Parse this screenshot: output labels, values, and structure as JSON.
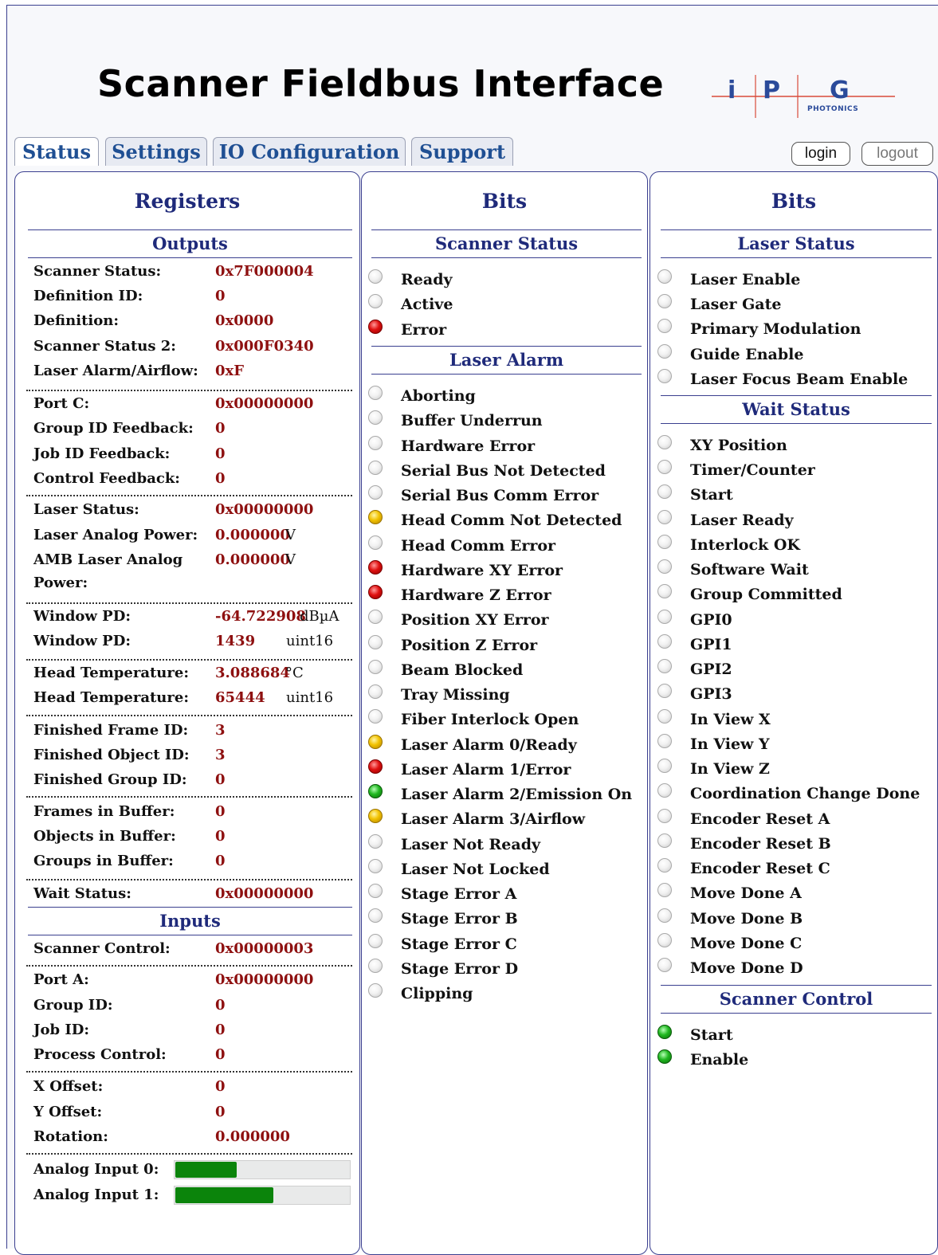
{
  "app": {
    "title": "Scanner Fieldbus Interface"
  },
  "logo": {
    "letters": [
      "i",
      "P",
      "G"
    ],
    "sub": "PHOTONICS"
  },
  "tabs": [
    {
      "label": "Status",
      "active": true
    },
    {
      "label": "Settings",
      "active": false
    },
    {
      "label": "IO Configuration",
      "active": false
    },
    {
      "label": "Support",
      "active": false
    }
  ],
  "auth": {
    "login": "login",
    "logout": "logout"
  },
  "registers": {
    "title": "Registers",
    "outputs_title": "Outputs",
    "inputs_title": "Inputs",
    "outputs": [
      {
        "label": "Scanner Status:",
        "value": "0x7F000004"
      },
      {
        "label": "Definition ID:",
        "value": "0"
      },
      {
        "label": "Definition:",
        "value": "0x0000"
      },
      {
        "label": "Scanner Status 2:",
        "value": "0x000F0340"
      },
      {
        "label": "Laser Alarm/Airflow:",
        "value": "0xF"
      },
      {
        "label": "Port C:",
        "value": "0x00000000"
      },
      {
        "label": "Group ID Feedback:",
        "value": "0"
      },
      {
        "label": "Job ID Feedback:",
        "value": "0"
      },
      {
        "label": "Control Feedback:",
        "value": "0"
      },
      {
        "label": "Laser Status:",
        "value": "0x00000000"
      },
      {
        "label": "Laser Analog Power:",
        "value": "0.000000",
        "unit": "V"
      },
      {
        "label": "AMB Laser Analog",
        "label2": "Power:",
        "value": "0.000000",
        "unit": "V"
      },
      {
        "label": "Window PD:",
        "value": "-64.722908",
        "unit": "dBµA"
      },
      {
        "label": "Window PD:",
        "value": "1439",
        "unit": "uint16"
      },
      {
        "label": "Head Temperature:",
        "value": "3.088684",
        "unit": "°C"
      },
      {
        "label": "Head Temperature:",
        "value": "65444",
        "unit": "uint16"
      },
      {
        "label": "Finished Frame ID:",
        "value": "3"
      },
      {
        "label": "Finished Object ID:",
        "value": "3"
      },
      {
        "label": "Finished Group ID:",
        "value": "0"
      },
      {
        "label": "Frames in Buffer:",
        "value": "0"
      },
      {
        "label": "Objects in Buffer:",
        "value": "0"
      },
      {
        "label": "Groups in Buffer:",
        "value": "0"
      },
      {
        "label": "Wait Status:",
        "value": "0x00000000"
      }
    ],
    "inputs": [
      {
        "label": "Scanner Control:",
        "value": "0x00000003"
      },
      {
        "label": "Port A:",
        "value": "0x00000000"
      },
      {
        "label": "Group ID:",
        "value": "0"
      },
      {
        "label": "Job ID:",
        "value": "0"
      },
      {
        "label": "Process Control:",
        "value": "0"
      },
      {
        "label": "X Offset:",
        "value": "0"
      },
      {
        "label": "Y Offset:",
        "value": "0"
      },
      {
        "label": "Rotation:",
        "value": "0.000000"
      }
    ],
    "analog": [
      {
        "label": "Analog Input 0:",
        "level": 0.35
      },
      {
        "label": "Analog Input 1:",
        "level": 0.56
      }
    ]
  },
  "bits_mid": {
    "title": "Bits",
    "scanner_status": {
      "title": "Scanner Status",
      "items": [
        {
          "label": "Ready",
          "state": "off"
        },
        {
          "label": "Active",
          "state": "off"
        },
        {
          "label": "Error",
          "state": "red"
        }
      ]
    },
    "laser_alarm": {
      "title": "Laser Alarm",
      "items": [
        {
          "label": "Aborting",
          "state": "off"
        },
        {
          "label": "Buffer Underrun",
          "state": "off"
        },
        {
          "label": "Hardware Error",
          "state": "off"
        },
        {
          "label": "Serial Bus Not Detected",
          "state": "off"
        },
        {
          "label": "Serial Bus Comm Error",
          "state": "off"
        },
        {
          "label": "Head Comm Not Detected",
          "state": "yellow"
        },
        {
          "label": "Head Comm Error",
          "state": "off"
        },
        {
          "label": "Hardware XY Error",
          "state": "red"
        },
        {
          "label": "Hardware Z Error",
          "state": "red"
        },
        {
          "label": "Position XY Error",
          "state": "off"
        },
        {
          "label": "Position Z Error",
          "state": "off"
        },
        {
          "label": "Beam Blocked",
          "state": "off"
        },
        {
          "label": "Tray Missing",
          "state": "off"
        },
        {
          "label": "Fiber Interlock Open",
          "state": "off"
        },
        {
          "label": "Laser Alarm 0/Ready",
          "state": "yellow"
        },
        {
          "label": "Laser Alarm 1/Error",
          "state": "red"
        },
        {
          "label": "Laser Alarm 2/Emission On",
          "state": "green"
        },
        {
          "label": "Laser Alarm 3/Airflow",
          "state": "yellow"
        },
        {
          "label": "Laser Not Ready",
          "state": "off"
        },
        {
          "label": "Laser Not Locked",
          "state": "off"
        },
        {
          "label": "Stage Error A",
          "state": "off"
        },
        {
          "label": "Stage Error B",
          "state": "off"
        },
        {
          "label": "Stage Error C",
          "state": "off"
        },
        {
          "label": "Stage Error D",
          "state": "off"
        },
        {
          "label": "Clipping",
          "state": "off"
        }
      ]
    }
  },
  "bits_right": {
    "title": "Bits",
    "laser_status": {
      "title": "Laser Status",
      "items": [
        {
          "label": "Laser Enable",
          "state": "off"
        },
        {
          "label": "Laser Gate",
          "state": "off"
        },
        {
          "label": "Primary Modulation",
          "state": "off"
        },
        {
          "label": "Guide Enable",
          "state": "off"
        },
        {
          "label": "Laser Focus Beam Enable",
          "state": "off"
        }
      ]
    },
    "wait_status": {
      "title": "Wait Status",
      "items": [
        {
          "label": "XY Position",
          "state": "off"
        },
        {
          "label": "Timer/Counter",
          "state": "off"
        },
        {
          "label": "Start",
          "state": "off"
        },
        {
          "label": "Laser Ready",
          "state": "off"
        },
        {
          "label": "Interlock OK",
          "state": "off"
        },
        {
          "label": "Software Wait",
          "state": "off"
        },
        {
          "label": "Group Committed",
          "state": "off"
        },
        {
          "label": "GPI0",
          "state": "off"
        },
        {
          "label": "GPI1",
          "state": "off"
        },
        {
          "label": "GPI2",
          "state": "off"
        },
        {
          "label": "GPI3",
          "state": "off"
        },
        {
          "label": "In View X",
          "state": "off"
        },
        {
          "label": "In View Y",
          "state": "off"
        },
        {
          "label": "In View Z",
          "state": "off"
        },
        {
          "label": "Coordination Change Done",
          "state": "off"
        },
        {
          "label": "Encoder Reset A",
          "state": "off"
        },
        {
          "label": "Encoder Reset B",
          "state": "off"
        },
        {
          "label": "Encoder Reset C",
          "state": "off"
        },
        {
          "label": "Move Done A",
          "state": "off"
        },
        {
          "label": "Move Done B",
          "state": "off"
        },
        {
          "label": "Move Done C",
          "state": "off"
        },
        {
          "label": "Move Done D",
          "state": "off"
        }
      ]
    },
    "scanner_control": {
      "title": "Scanner Control",
      "items": [
        {
          "label": "Start",
          "state": "green"
        },
        {
          "label": "Enable",
          "state": "green"
        }
      ]
    }
  },
  "colors": {
    "accent": "#1f2a7a",
    "tab_text": "#1f4f93",
    "value_text": "#8e1010",
    "led_red": "#e01010",
    "led_yellow": "#f2c200",
    "led_green": "#20b820",
    "bar_fill": "#0b840b"
  }
}
